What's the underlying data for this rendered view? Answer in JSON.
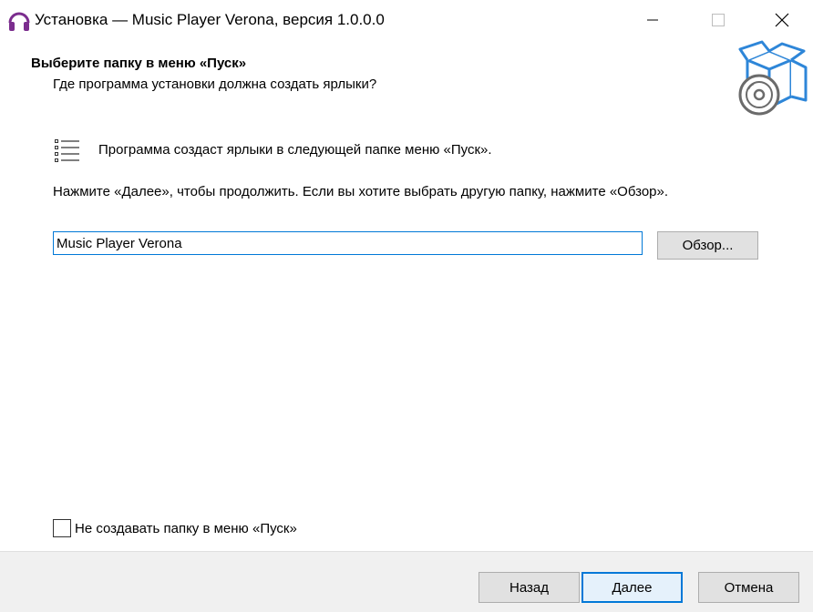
{
  "window": {
    "title": "Установка — Music Player Verona, версия 1.0.0.0",
    "app_icon": "headphones-icon",
    "controls": [
      "minimize-icon",
      "maximize-icon",
      "close-icon"
    ]
  },
  "header": {
    "title": "Выберите папку в меню «Пуск»",
    "subtitle": "Где программа установки должна создать ярлыки?",
    "icon": "box-with-disc-icon"
  },
  "body": {
    "info_icon": "list-icon",
    "info_text": "Программа создаст ярлыки в следующей папке меню «Пуск».",
    "hint_text": "Нажмите «Далее», чтобы продолжить. Если вы хотите выбрать другую папку, нажмите «Обзор».",
    "folder_value": "Music Player Verona",
    "browse_label": "Обзор...",
    "no_folder_checkbox_label": "Не создавать папку в меню «Пуск»",
    "no_folder_checked": false
  },
  "footer": {
    "back_label": "Назад",
    "next_label": "Далее",
    "cancel_label": "Отмена"
  },
  "colors": {
    "accent": "#0078d7",
    "icon_purple": "#7b2d8e",
    "footer_bg": "#f0f0f0"
  }
}
